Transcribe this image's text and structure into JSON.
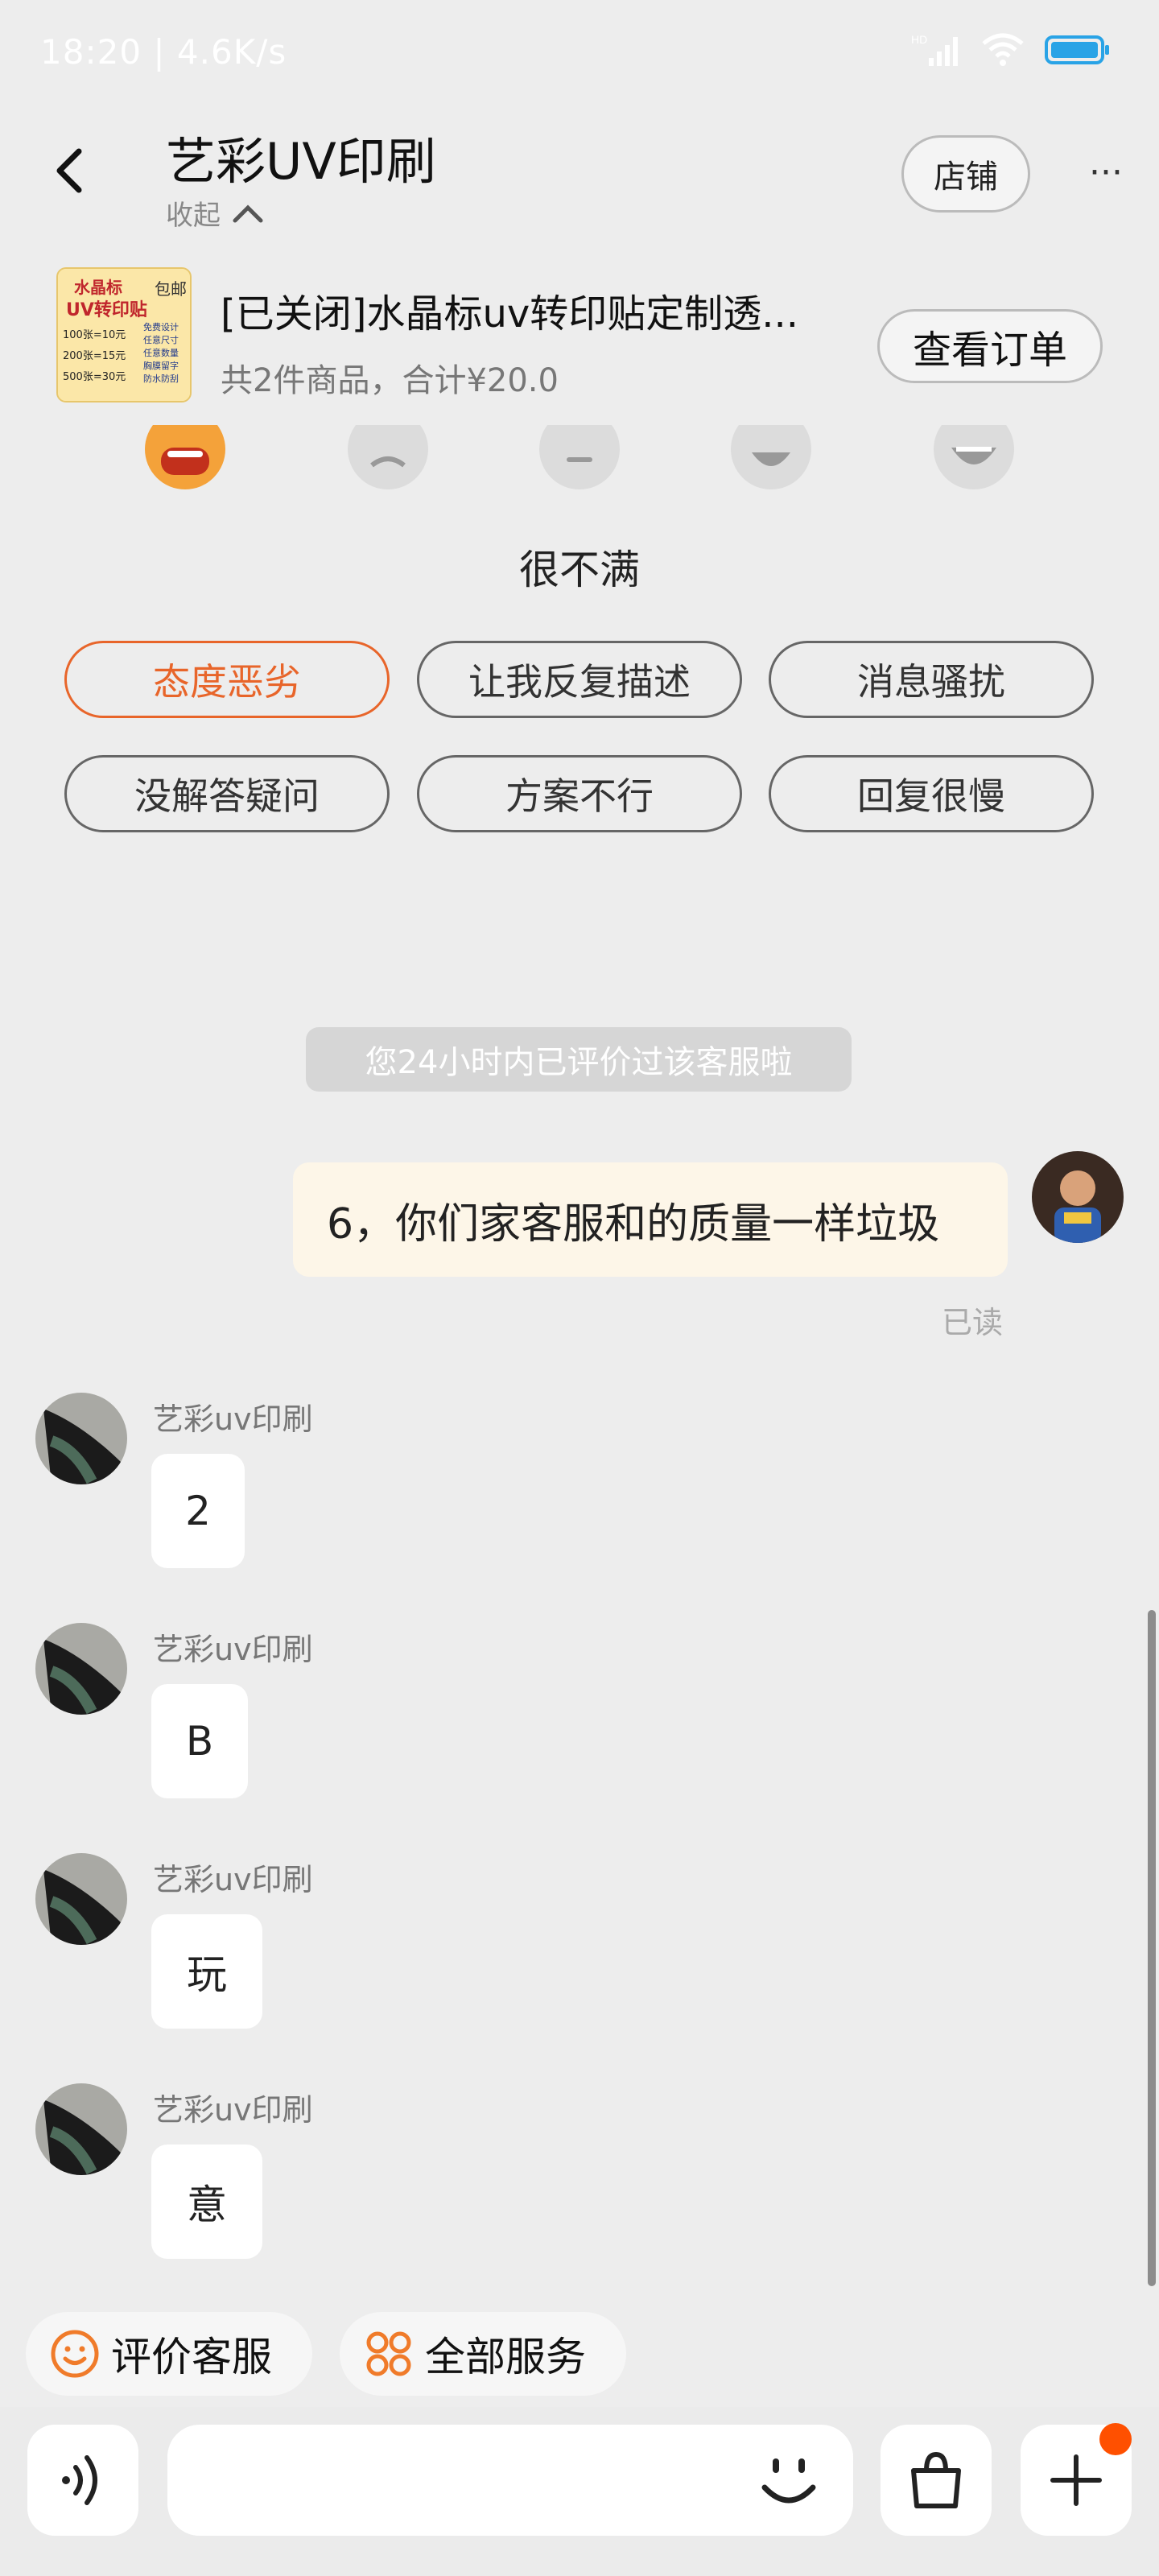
{
  "status_bar": {
    "time": "18:20",
    "speed": "4.6K/s",
    "hd_label": "HD"
  },
  "header": {
    "title": "艺彩UV印刷",
    "collapse_label": "收起",
    "store_button": "店铺",
    "more_label": "···"
  },
  "order": {
    "title": "[已关闭]水晶标uv转印贴定制透...",
    "summary": "共2件商品，合计¥20.0",
    "view_button": "查看订单",
    "thumb": {
      "headline": "水晶标",
      "headline2": "UV转印贴",
      "badge": "包邮",
      "lines": [
        "100张=10元",
        "200张=15元",
        "500张=30元"
      ],
      "features": [
        "免费设计",
        "任意尺寸",
        "任意数量",
        "胸膜留字",
        "防水防刮"
      ]
    }
  },
  "rating": {
    "label": "很不满",
    "tags": [
      {
        "text": "态度恶劣",
        "active": true
      },
      {
        "text": "让我反复描述",
        "active": false
      },
      {
        "text": "消息骚扰",
        "active": false
      },
      {
        "text": "没解答疑问",
        "active": false
      },
      {
        "text": "方案不行",
        "active": false
      },
      {
        "text": "回复很慢",
        "active": false
      }
    ]
  },
  "notice": "您24小时内已评价过该客服啦",
  "messages": {
    "mine": {
      "text": "6，你们家客服和的质量一样垃圾",
      "status": "已读"
    },
    "theirs": [
      {
        "sender": "艺彩uv印刷",
        "text": "2"
      },
      {
        "sender": "艺彩uv印刷",
        "text": "B"
      },
      {
        "sender": "艺彩uv印刷",
        "text": "玩"
      },
      {
        "sender": "艺彩uv印刷",
        "text": "意"
      }
    ]
  },
  "services": {
    "rate_label": "评价客服",
    "all_label": "全部服务"
  },
  "input": {
    "placeholder": ""
  },
  "colors": {
    "accent": "#e8652a",
    "notice_bg": "#d6d6d6",
    "my_bubble": "#fdf6e8",
    "badge": "#ff5000"
  },
  "icons": [
    "back-icon",
    "chevron-up-icon",
    "more-icon",
    "voice-icon",
    "emoji-icon",
    "bag-icon",
    "plus-icon",
    "smile-icon",
    "grid-icon"
  ]
}
